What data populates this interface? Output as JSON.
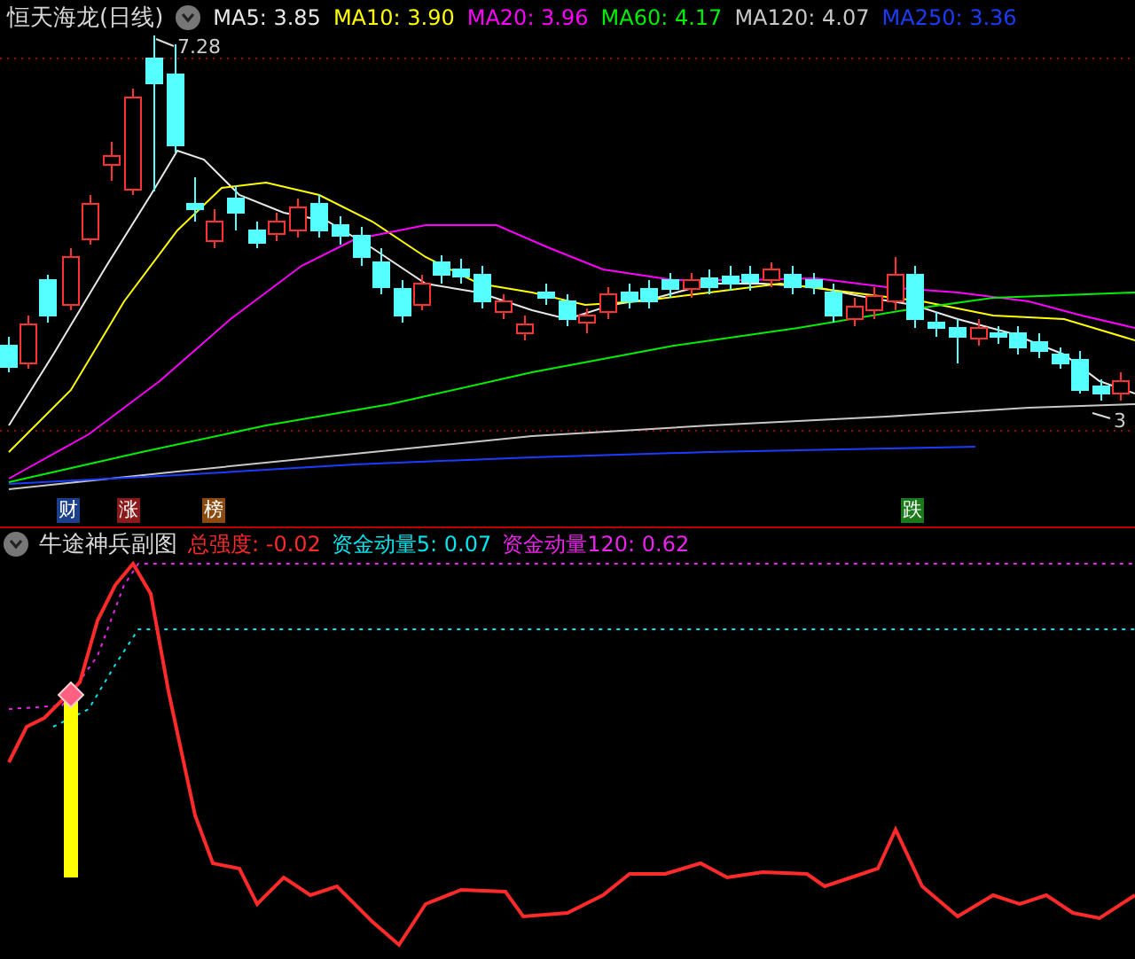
{
  "main_chart": {
    "title": "恒天海龙(日线)",
    "indicators": [
      {
        "text": "MA5: 3.85",
        "color": "#e8e8e8"
      },
      {
        "text": "MA10: 3.90",
        "color": "#ffff00"
      },
      {
        "text": "MA20: 3.96",
        "color": "#ff00ff"
      },
      {
        "text": "MA60: 4.17",
        "color": "#00ee00"
      },
      {
        "text": "MA120: 4.07",
        "color": "#c8c8c8"
      },
      {
        "text": "MA250: 3.36",
        "color": "#1a3cff"
      }
    ],
    "high_label": "7.28",
    "low_label": "3"
  },
  "markers": [
    {
      "text": "财",
      "color": "#1b3f8a"
    },
    {
      "text": "涨",
      "color": "#8b1a1a"
    },
    {
      "text": "榜",
      "color": "#8a4a10"
    },
    {
      "text": "跌",
      "color": "#1a7a1a"
    }
  ],
  "sub_chart": {
    "title": "牛途神兵副图",
    "indicators": [
      {
        "text": "总强度: -0.02",
        "color": "#ff2a2a"
      },
      {
        "text": "资金动量5: 0.07",
        "color": "#00e5ee"
      },
      {
        "text": "资金动量120: 0.62",
        "color": "#ee22ee"
      }
    ]
  }
}
